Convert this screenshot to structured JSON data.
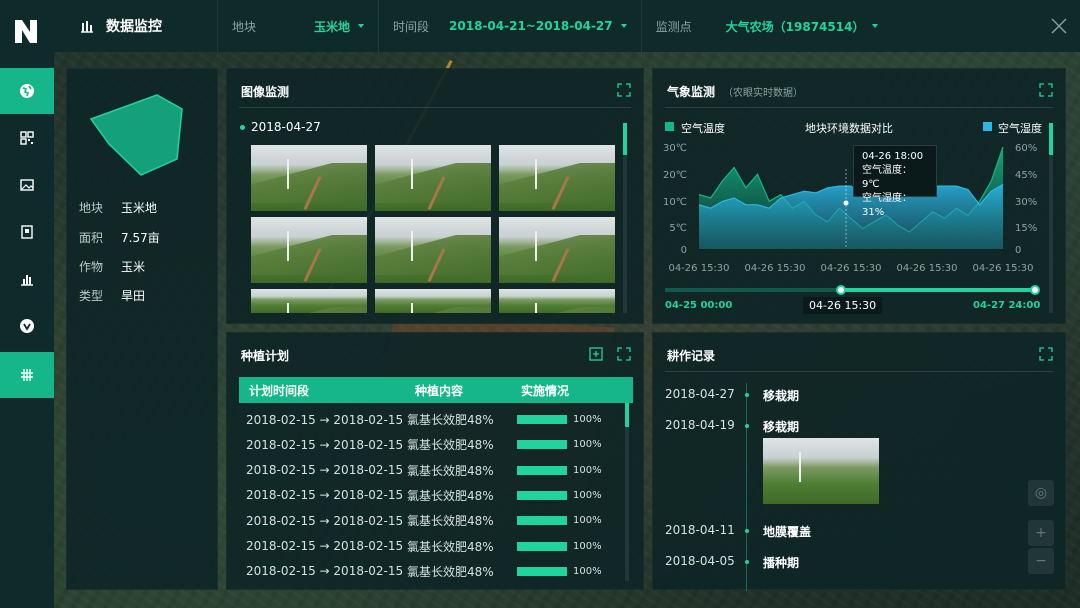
{
  "header": {
    "title": "数据监控",
    "field_label": "地块",
    "field_value": "玉米地",
    "period_label": "时间段",
    "period_value": "2018-04-21~2018-04-27",
    "station_label": "监测点",
    "station_value": "大气农场（19874514）"
  },
  "sidebar": {
    "items": [
      {
        "icon": "globe-icon",
        "active": true
      },
      {
        "icon": "grid-icon",
        "active": false
      },
      {
        "icon": "image-icon",
        "active": false
      },
      {
        "icon": "document-icon",
        "active": false
      },
      {
        "icon": "bar-chart-icon",
        "active": false
      },
      {
        "icon": "check-circle-icon",
        "active": false
      },
      {
        "icon": "field-grid-icon",
        "active": true
      }
    ]
  },
  "field_info": {
    "rows": [
      {
        "key": "地块",
        "value": "玉米地"
      },
      {
        "key": "面积",
        "value": "7.57亩"
      },
      {
        "key": "作物",
        "value": "玉米"
      },
      {
        "key": "类型",
        "value": "旱田"
      }
    ]
  },
  "image_monitor": {
    "title": "图像监测",
    "date": "2018-04-27",
    "thumb_count": 9
  },
  "weather": {
    "title": "气象监测",
    "subtitle": "（农眼实时数据）",
    "chart_title": "地块环境数据对比",
    "tooltip": {
      "time": "04-26 18:00",
      "temp": "空气温度： 9℃",
      "humidity": "空气湿度： 31%"
    },
    "slider": {
      "start": "04-25  00:00",
      "current": "04-26  15:30",
      "end": "04-27  24:00"
    }
  },
  "chart_data": {
    "type": "area",
    "series": [
      {
        "name": "空气温度",
        "axis": "left",
        "color": "#14b68a",
        "values": [
          16,
          15,
          20,
          24,
          18,
          22,
          14,
          16,
          12,
          14,
          10,
          8,
          12,
          9,
          6,
          8,
          10,
          7,
          5,
          8,
          11,
          9,
          12,
          10,
          14,
          20,
          30
        ]
      },
      {
        "name": "空气湿度",
        "axis": "right",
        "color": "#2bb7e6",
        "values": [
          26,
          24,
          28,
          30,
          26,
          26,
          24,
          30,
          32,
          34,
          33,
          36,
          37,
          37,
          31,
          33,
          36,
          37,
          36,
          37,
          37,
          37,
          37,
          35,
          26,
          34,
          38
        ]
      }
    ],
    "x_tick_labels": [
      "04-26 15:30",
      "04-26 15:30",
      "04-26 15:30",
      "04-26 15:30",
      "04-26 15:30"
    ],
    "y_left": {
      "ticks": [
        "30℃",
        "20℃",
        "10℃",
        "5℃",
        "0"
      ],
      "range": [
        0,
        30
      ]
    },
    "y_right": {
      "ticks": [
        "60%",
        "45%",
        "30%",
        "15%",
        "0"
      ],
      "range": [
        0,
        60
      ]
    },
    "legend": [
      "空气温度",
      "空气湿度"
    ]
  },
  "planting_plan": {
    "title": "种植计划",
    "columns": [
      "计划时间段",
      "种植内容",
      "实施情况"
    ],
    "rows": [
      {
        "period": "2018-02-15 → 2018-02-15",
        "content": "氯基长效肥48%",
        "progress": "100%"
      },
      {
        "period": "2018-02-15 → 2018-02-15",
        "content": "氯基长效肥48%",
        "progress": "100%"
      },
      {
        "period": "2018-02-15 → 2018-02-15",
        "content": "氯基长效肥48%",
        "progress": "100%"
      },
      {
        "period": "2018-02-15 → 2018-02-15",
        "content": "氯基长效肥48%",
        "progress": "100%"
      },
      {
        "period": "2018-02-15 → 2018-02-15",
        "content": "氯基长效肥48%",
        "progress": "100%"
      },
      {
        "period": "2018-02-15 → 2018-02-15",
        "content": "氯基长效肥48%",
        "progress": "100%"
      },
      {
        "period": "2018-02-15 → 2018-02-15",
        "content": "氯基长效肥48%",
        "progress": "100%"
      }
    ]
  },
  "farm_log": {
    "title": "耕作记录",
    "entries": [
      {
        "date": "2018-04-27",
        "event": "移栽期"
      },
      {
        "date": "2018-04-19",
        "event": "移栽期"
      },
      {
        "date": "2018-04-11",
        "event": "地膜覆盖"
      },
      {
        "date": "2018-04-05",
        "event": "播种期"
      }
    ]
  },
  "colors": {
    "accent": "#21d39c",
    "accent_dark": "#14b68a",
    "humidity": "#2bb7e6",
    "panel_bg": "#0e2626"
  }
}
